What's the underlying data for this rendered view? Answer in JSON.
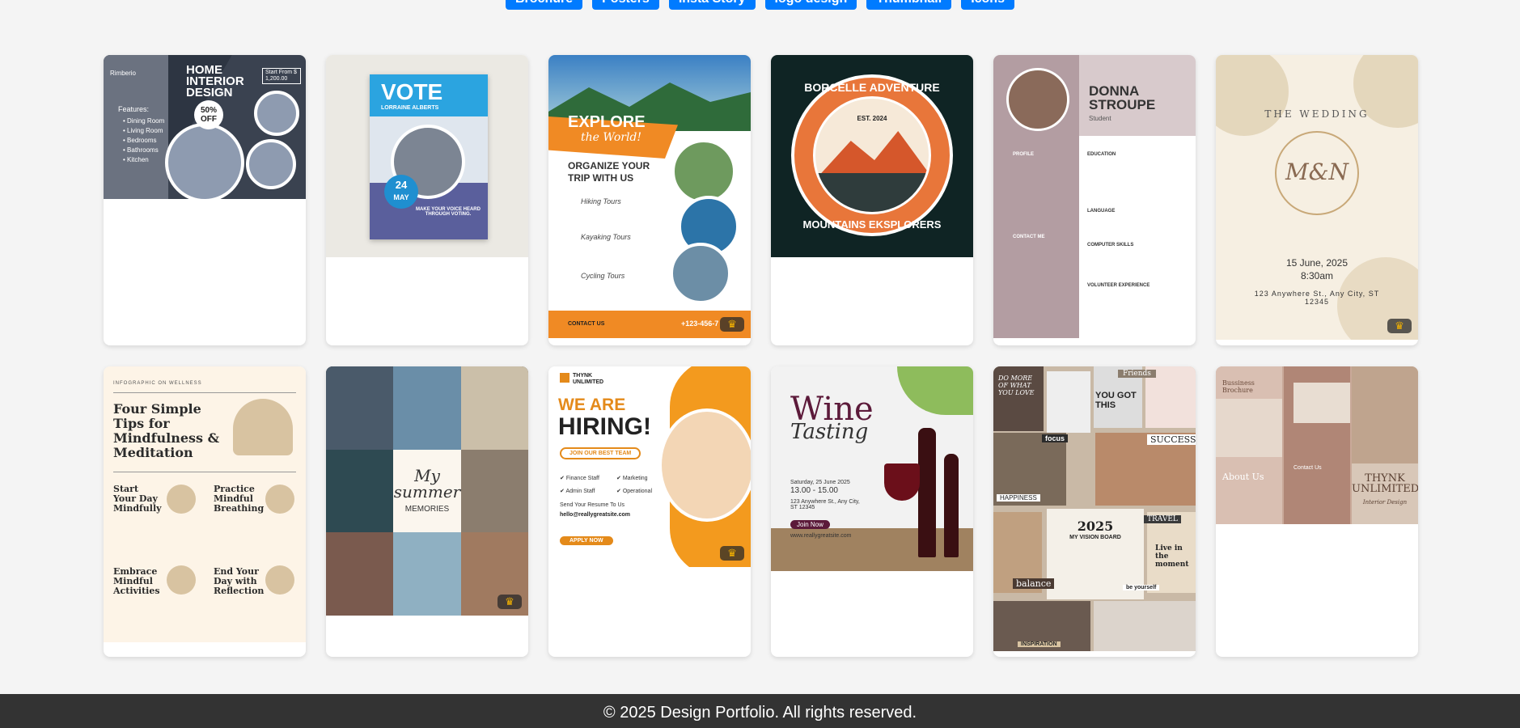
{
  "filters": [
    "Brochure",
    "Posters",
    "Insta Story",
    "logo design",
    "Thumbnail",
    "Icons"
  ],
  "cards": [
    {
      "name": "home-interior-design",
      "lines": [
        "HOME",
        "INTERIOR",
        "DESIGN",
        "50%",
        "OFF",
        "Features:",
        "Rimberio",
        "Start From $ 1,200.00"
      ],
      "features": [
        "Dining Room",
        "Living Room",
        "Bedrooms",
        "Bathrooms",
        "Kitchen"
      ]
    },
    {
      "name": "vote-poster",
      "title": "VOTE",
      "person": "LORRAINE ALBERTS",
      "day": "24",
      "month": "MAY",
      "slogan": "MAKE YOUR VOICE HEARD THROUGH VOTING."
    },
    {
      "name": "explore-the-world",
      "title": "EXPLORE",
      "subtitle": "the World!",
      "heading": "ORGANIZE YOUR TRIP WITH US",
      "tours": [
        "Hiking Tours",
        "Kayaking Tours",
        "Cycling Tours"
      ],
      "contact": "CONTACT US",
      "phone": "+123-456-7"
    },
    {
      "name": "borcelle-adventure",
      "top": "BORCELLE ADVENTURE",
      "est": "EST. 2024",
      "bottom": "MOUNTAINS EKSPLORERS"
    },
    {
      "name": "donna-stroupe-resume",
      "first": "DONNA",
      "last": "STROUPE",
      "role": "Student",
      "sections": [
        "EDUCATION",
        "LANGUAGE",
        "COMPUTER SKILLS",
        "VOLUNTEER EXPERIENCE"
      ],
      "side": [
        "PROFILE",
        "CONTACT ME"
      ]
    },
    {
      "name": "the-wedding",
      "title": "THE WEDDING",
      "monogram": "M&N",
      "date": "15 June, 2025",
      "time": "8:30am",
      "address": "123 Anywhere St., Any City, ST 12345"
    },
    {
      "name": "four-simple-tips",
      "tag": "INFOGRAPHIC ON WELLNESS",
      "title": "Four Simple Tips for Mindfulness & Meditation",
      "tips": [
        "Start Your Day Mindfully",
        "Practice Mindful Breathing",
        "Embrace Mindful Activities",
        "End Your Day with Reflection"
      ]
    },
    {
      "name": "my-summer-memories",
      "line1": "My",
      "line2": "summer",
      "line3": "MEMORIES"
    },
    {
      "name": "we-are-hiring",
      "brand": "THYNK UNLIMITED",
      "line1": "WE ARE",
      "line2": "HIRING!",
      "cta": "JOIN OUR BEST TEAM",
      "roles": [
        "Finance Staff",
        "Marketing",
        "Admin Staff",
        "Operational"
      ],
      "resume": "Send Your Resume To Us",
      "email": "hello@reallygreatsite.com",
      "apply": "APPLY NOW"
    },
    {
      "name": "wine-tasting",
      "title1": "Wine",
      "title2": "Tasting",
      "date": "Saturday, 25 June 2025",
      "time": "13.00 - 15.00",
      "address": "123 Anywhere St., Any City, ST 12345",
      "cta": "Join Now",
      "site": "www.reallygreatsite.com"
    },
    {
      "name": "vision-board",
      "items": [
        "DO MORE OF WHAT YOU LOVE",
        "Friends",
        "YOU GOT THIS",
        "focus",
        "SUCCESS",
        "HAPPINESS",
        "2025",
        "MY VISION BOARD",
        "TRAVEL",
        "balance",
        "Live in the moment",
        "be yourself",
        "INSPIRATION"
      ]
    },
    {
      "name": "business-brochure",
      "title": "Bussiness Brochure",
      "about": "About Us",
      "contact": "Contact Us",
      "brand": "THYNK UNLIMITED",
      "sub": "Interior Design"
    }
  ],
  "footer": "© 2025 Design Portfolio. All rights reserved.",
  "colors": {
    "accent": "#007bff",
    "footer_bg": "#333333",
    "page_bg": "#f4f4f4"
  }
}
